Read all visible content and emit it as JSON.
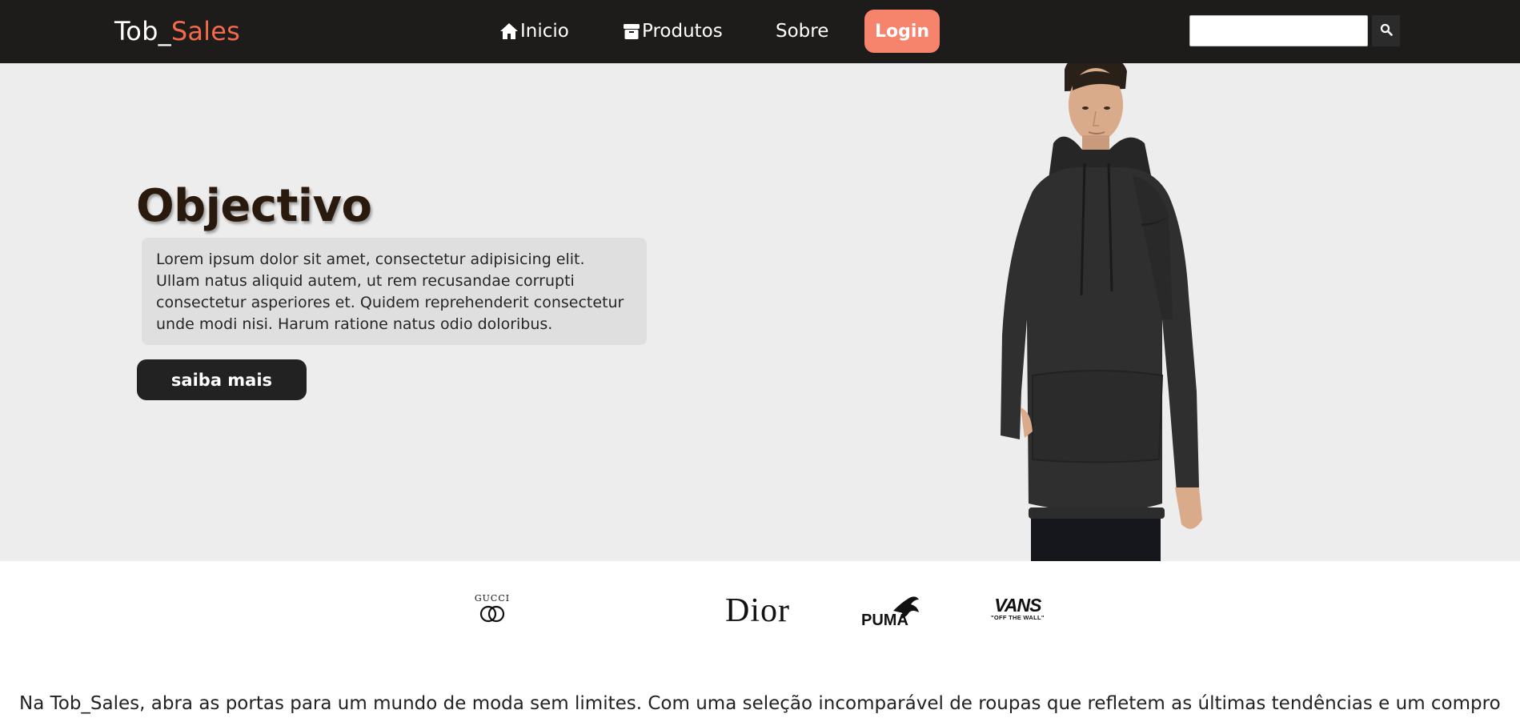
{
  "header": {
    "brand_prefix": "Tob_",
    "brand_accent": "Sales",
    "nav": {
      "inicio": "Inicio",
      "produtos": "Produtos",
      "sobre": "Sobre"
    },
    "login_label": "Login",
    "search": {
      "value": "",
      "placeholder": ""
    },
    "icons": {
      "inicio": "home-icon",
      "produtos": "box-icon",
      "search": "search-icon"
    }
  },
  "hero": {
    "title": "Objectivo",
    "paragraph": "Lorem ipsum dolor sit amet, consectetur adipisicing elit. Ullam natus aliquid autem, ut rem recusandae corrupti consectetur asperiores et. Quidem reprehenderit consectetur unde modi nisi. Harum ratione natus odio doloribus.",
    "cta_label": "saiba mais"
  },
  "brands": {
    "gucci": "GUCCI",
    "dior": "Dior",
    "puma": "PUMA",
    "vans": "VANS",
    "vans_tagline": "\"OFF THE WALL\""
  },
  "intro": {
    "text": "Na Tob_Sales, abra as portas para um mundo de moda sem limites. Com uma seleção incomparável de roupas que refletem as últimas tendências e um compromisso"
  },
  "colors": {
    "navbar": "#1e1c1b",
    "accent": "#f26a4b",
    "login": "#f6836c",
    "hero_bg": "#ededed",
    "button_dark": "#222222"
  }
}
